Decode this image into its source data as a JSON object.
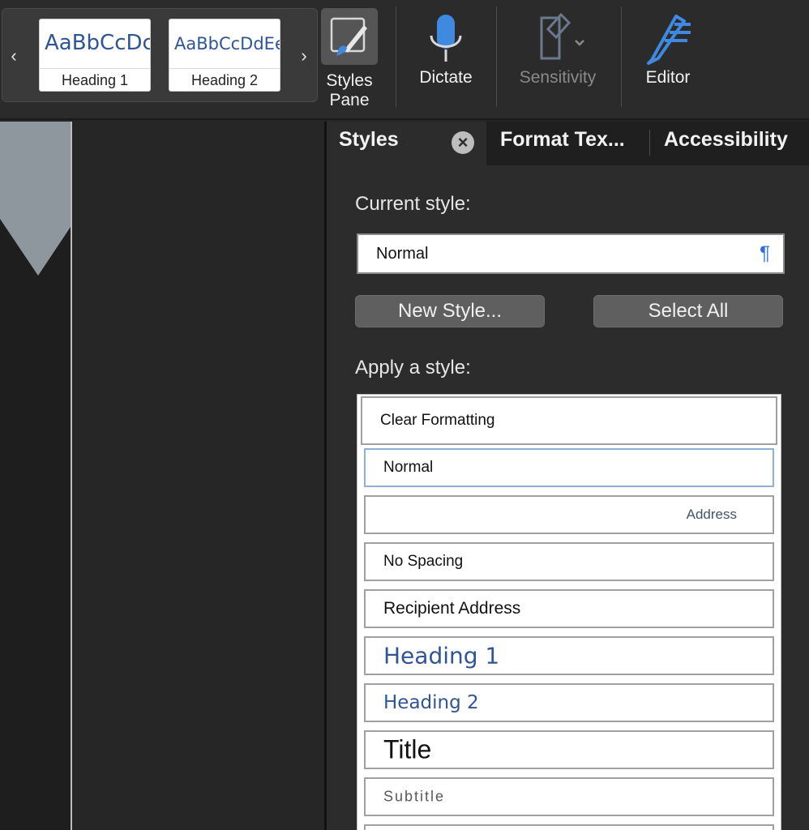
{
  "ribbon": {
    "gallery": [
      {
        "sample": "AaBbCcDc",
        "caption": "Heading 1"
      },
      {
        "sample": "AaBbCcDdEe",
        "caption": "Heading 2"
      }
    ],
    "styles_pane_label_line1": "Styles",
    "styles_pane_label_line2": "Pane",
    "dictate_label": "Dictate",
    "sensitivity_label": "Sensitivity",
    "editor_label": "Editor"
  },
  "pane": {
    "tabs": [
      "Styles",
      "Format Tex...",
      "Accessibility"
    ],
    "current_style_label": "Current style:",
    "current_style_value": "Normal",
    "pilcrow": "¶",
    "new_style_button": "New Style...",
    "select_all_button": "Select All",
    "apply_label": "Apply a style:",
    "styles": [
      {
        "name": "Clear Formatting"
      },
      {
        "name": "Normal"
      },
      {
        "name": "Address"
      },
      {
        "name": "No Spacing"
      },
      {
        "name": "Recipient Address"
      },
      {
        "name": "Heading 1"
      },
      {
        "name": "Heading 2"
      },
      {
        "name": "Title"
      },
      {
        "name": "Subtitle"
      }
    ]
  },
  "colors": {
    "accent_blue": "#2f6fd6",
    "heading_blue": "#2f5597"
  }
}
